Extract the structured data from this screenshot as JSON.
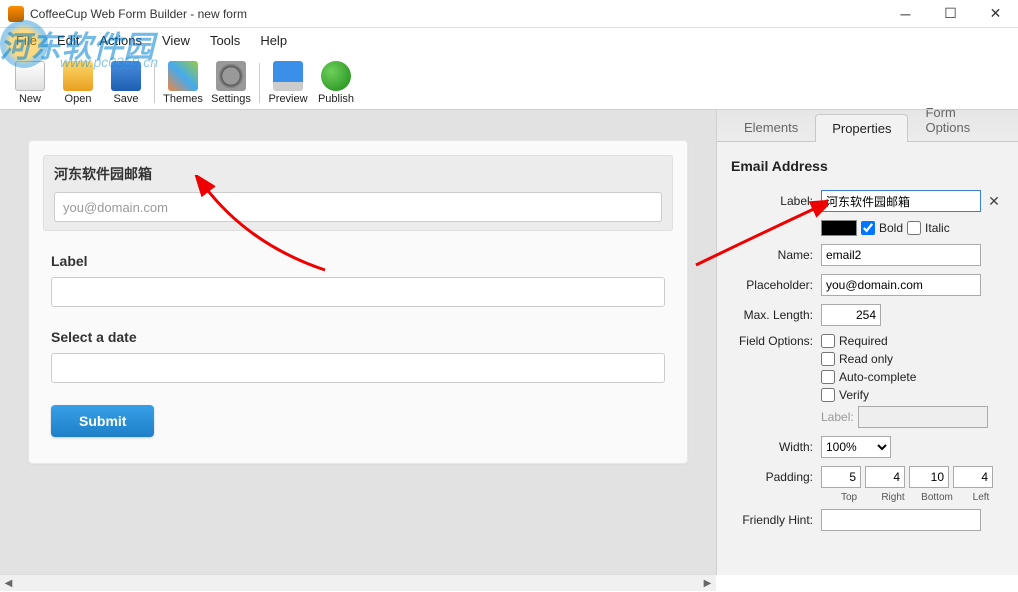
{
  "window": {
    "title": "CoffeeCup Web Form Builder - new form"
  },
  "watermark": {
    "text": "河东软件园",
    "url": "www.pc0359.cn"
  },
  "menu": {
    "file": "File",
    "edit": "Edit",
    "actions": "Actions",
    "view": "View",
    "tools": "Tools",
    "help": "Help"
  },
  "toolbar": {
    "new": "New",
    "open": "Open",
    "save": "Save",
    "themes": "Themes",
    "settings": "Settings",
    "preview": "Preview",
    "publish": "Publish"
  },
  "form": {
    "email_label": "河东软件园邮箱",
    "email_placeholder": "you@domain.com",
    "text_label": "Label",
    "date_label": "Select a date",
    "submit": "Submit"
  },
  "tabs": {
    "elements": "Elements",
    "properties": "Properties",
    "form_options": "Form Options"
  },
  "props": {
    "title": "Email Address",
    "label_lbl": "Label:",
    "label_val": "河东软件园邮箱",
    "bold": "Bold",
    "italic": "Italic",
    "bold_checked": true,
    "italic_checked": false,
    "name_lbl": "Name:",
    "name_val": "email2",
    "placeholder_lbl": "Placeholder:",
    "placeholder_val": "you@domain.com",
    "maxlen_lbl": "Max. Length:",
    "maxlen_val": "254",
    "fieldopt_lbl": "Field Options:",
    "required": "Required",
    "readonly": "Read only",
    "autocomplete": "Auto-complete",
    "verify": "Verify",
    "verify_label_lbl": "Label:",
    "width_lbl": "Width:",
    "width_val": "100%",
    "padding_lbl": "Padding:",
    "pad_top": "5",
    "pad_right": "4",
    "pad_bottom": "10",
    "pad_left": "4",
    "pad_top_l": "Top",
    "pad_right_l": "Right",
    "pad_bottom_l": "Bottom",
    "pad_left_l": "Left",
    "hint_lbl": "Friendly Hint:"
  }
}
